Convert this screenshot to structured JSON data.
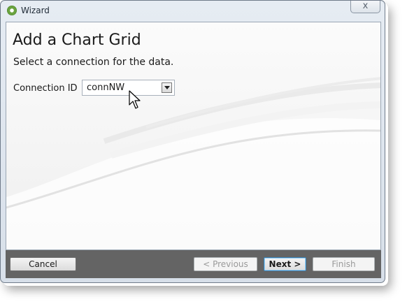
{
  "window": {
    "title": "Wizard",
    "close_label": "x"
  },
  "page": {
    "title": "Add a Chart Grid",
    "subtitle": "Select a connection for the data."
  },
  "form": {
    "connection_label": "Connection ID",
    "connection_value": "connNW"
  },
  "buttons": {
    "cancel": "Cancel",
    "previous": "< Previous",
    "next": "Next >",
    "finish": "Finish"
  }
}
